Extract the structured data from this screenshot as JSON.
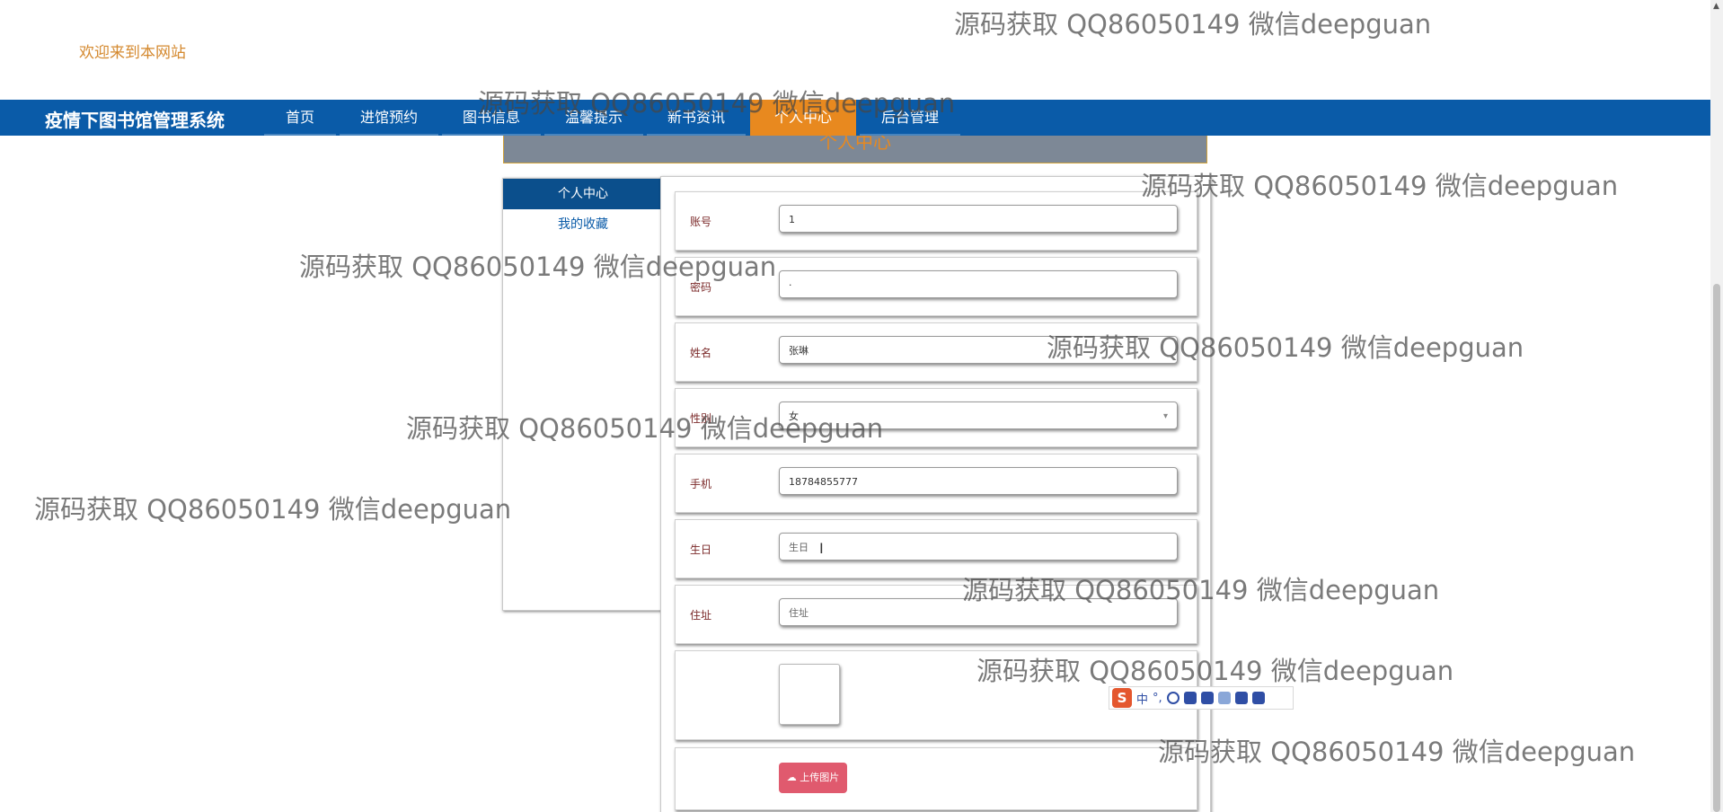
{
  "header": {
    "welcome": "欢迎来到本网站",
    "site_title": "疫情下图书馆管理系统"
  },
  "nav": {
    "items": [
      {
        "label": "首页",
        "active": false
      },
      {
        "label": "进馆预约",
        "active": false
      },
      {
        "label": "图书信息",
        "active": false
      },
      {
        "label": "温馨提示",
        "active": false
      },
      {
        "label": "新书资讯",
        "active": false
      },
      {
        "label": "个人中心",
        "active": true
      },
      {
        "label": "后台管理",
        "active": false
      }
    ],
    "brand_color": "#0a5ba8",
    "active_color": "#e8891f"
  },
  "banner": {
    "title": "个人中心"
  },
  "sidebar": {
    "items": [
      {
        "label": "个人中心",
        "active": true
      },
      {
        "label": "我的收藏",
        "active": false
      }
    ]
  },
  "form": {
    "fields": [
      {
        "label": "账号",
        "value": "1"
      },
      {
        "label": "密码",
        "value": "·"
      },
      {
        "label": "姓名",
        "value": "张琳"
      },
      {
        "label": "性别",
        "value": "女"
      },
      {
        "label": "手机",
        "value": "18784855777"
      },
      {
        "label": "生日",
        "placeholder": "生日"
      },
      {
        "label": "住址",
        "placeholder": "住址"
      }
    ],
    "upload_label": "上传图片",
    "upload_icon": "cloud-upload-icon"
  },
  "ime": {
    "logo": "S",
    "mode": "中",
    "punct": "°,"
  },
  "watermark_text": "源码获取 QQ86050149 微信deepguan"
}
